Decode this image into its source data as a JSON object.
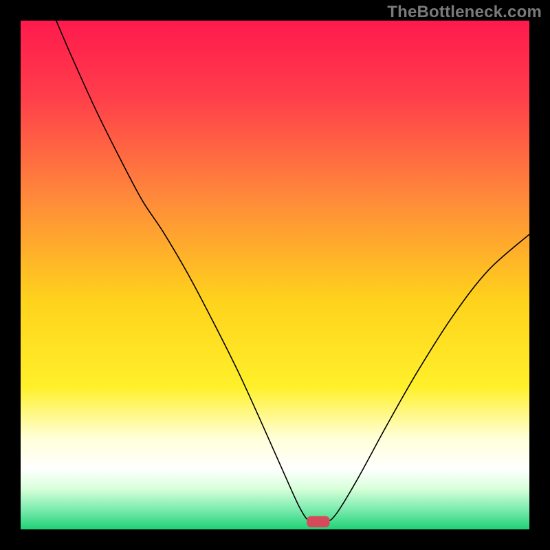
{
  "watermark": "TheBottleneck.com",
  "chart_data": {
    "type": "line",
    "title": "",
    "xlabel": "",
    "ylabel": "",
    "xlim": [
      0,
      100
    ],
    "ylim": [
      0,
      100
    ],
    "background": {
      "type": "vertical-gradient",
      "stops": [
        {
          "offset": 0.0,
          "color": "#ff1a4d"
        },
        {
          "offset": 0.15,
          "color": "#ff3e4b"
        },
        {
          "offset": 0.35,
          "color": "#ff8a3a"
        },
        {
          "offset": 0.55,
          "color": "#ffd21c"
        },
        {
          "offset": 0.72,
          "color": "#fff02a"
        },
        {
          "offset": 0.82,
          "color": "#ffffd8"
        },
        {
          "offset": 0.88,
          "color": "#ffffff"
        },
        {
          "offset": 0.92,
          "color": "#d8ffda"
        },
        {
          "offset": 0.96,
          "color": "#7eecb0"
        },
        {
          "offset": 1.0,
          "color": "#20d176"
        }
      ]
    },
    "marker": {
      "x": 58.5,
      "y": 1.5,
      "width": 4.5,
      "height": 2.2,
      "color": "#d44a5a",
      "shape": "rounded-rect"
    },
    "series": [
      {
        "name": "bottleneck-curve",
        "color": "#000000",
        "stroke_width": 1.6,
        "points": [
          {
            "x": 7.0,
            "y": 100.0
          },
          {
            "x": 10.0,
            "y": 93.0
          },
          {
            "x": 15.0,
            "y": 82.0
          },
          {
            "x": 20.0,
            "y": 72.0
          },
          {
            "x": 24.0,
            "y": 64.5
          },
          {
            "x": 28.0,
            "y": 58.5
          },
          {
            "x": 33.0,
            "y": 50.0
          },
          {
            "x": 38.0,
            "y": 40.5
          },
          {
            "x": 43.0,
            "y": 30.5
          },
          {
            "x": 48.0,
            "y": 19.5
          },
          {
            "x": 52.0,
            "y": 10.5
          },
          {
            "x": 55.0,
            "y": 4.0
          },
          {
            "x": 57.0,
            "y": 1.5
          },
          {
            "x": 60.0,
            "y": 1.5
          },
          {
            "x": 62.0,
            "y": 3.0
          },
          {
            "x": 66.0,
            "y": 9.5
          },
          {
            "x": 72.0,
            "y": 20.5
          },
          {
            "x": 78.0,
            "y": 31.0
          },
          {
            "x": 85.0,
            "y": 42.0
          },
          {
            "x": 92.0,
            "y": 51.0
          },
          {
            "x": 100.0,
            "y": 58.0
          }
        ]
      }
    ]
  }
}
